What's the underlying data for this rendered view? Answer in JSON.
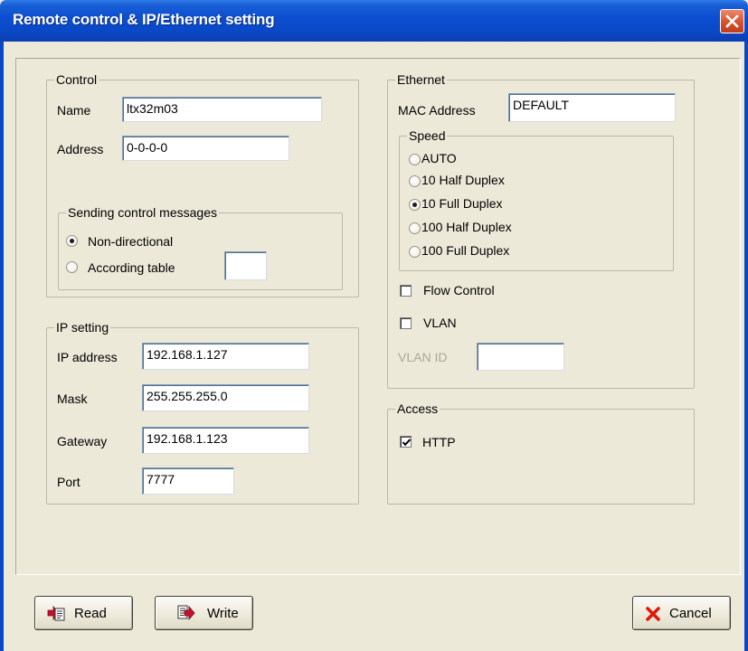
{
  "window": {
    "title": "Remote control & IP/Ethernet setting"
  },
  "control": {
    "group_label": "Control",
    "name_label": "Name",
    "name_value": "ltx32m03",
    "address_label": "Address",
    "address_value": "0-0-0-0",
    "sending": {
      "group_label": "Sending control messages",
      "options": [
        {
          "label": "Non-directional",
          "checked": true
        },
        {
          "label": "According table",
          "checked": false
        }
      ],
      "table_value": ""
    }
  },
  "ip_setting": {
    "group_label": "IP setting",
    "ip_label": "IP address",
    "ip_value": "192.168.1.127",
    "mask_label": "Mask",
    "mask_value": "255.255.255.0",
    "gateway_label": "Gateway",
    "gateway_value": "192.168.1.123",
    "port_label": "Port",
    "port_value": "7777"
  },
  "ethernet": {
    "group_label": "Ethernet",
    "mac_label": "MAC Address",
    "mac_value": "DEFAULT",
    "speed": {
      "group_label": "Speed",
      "options": [
        {
          "label": "AUTO",
          "checked": false
        },
        {
          "label": "10 Half Duplex",
          "checked": false
        },
        {
          "label": "10 Full Duplex",
          "checked": true
        },
        {
          "label": "100 Half Duplex",
          "checked": false
        },
        {
          "label": "100 Full Duplex",
          "checked": false
        }
      ]
    },
    "flow_control": {
      "label": "Flow Control",
      "checked": false
    },
    "vlan": {
      "label": "VLAN",
      "checked": false
    },
    "vlan_id_label": "VLAN ID",
    "vlan_id_value": ""
  },
  "access": {
    "group_label": "Access",
    "http": {
      "label": "HTTP",
      "checked": true
    }
  },
  "buttons": {
    "read": "Read",
    "write": "Write",
    "cancel": "Cancel"
  },
  "icons": {
    "read": "read-icon",
    "write": "write-icon",
    "cancel": "cancel-x-icon",
    "close": "close-icon"
  },
  "colors": {
    "titlebar": "#0a48c6",
    "dialog_bg": "#ece9d8",
    "close_button": "#d8512d",
    "cancel_x": "#e0180a"
  }
}
